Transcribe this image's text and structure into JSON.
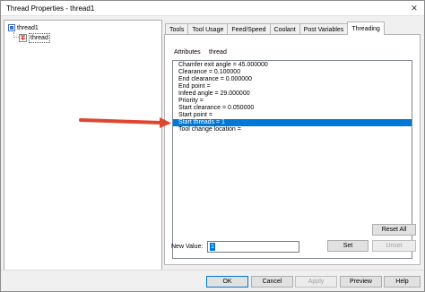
{
  "window": {
    "title": "Thread Properties - thread1",
    "close_glyph": "✕"
  },
  "tree": {
    "root": {
      "label": "thread1",
      "icon": "operation-icon"
    },
    "child": {
      "label": "thread",
      "icon": "thread-tool-icon"
    }
  },
  "tabs": [
    {
      "label": "Tools",
      "active": false
    },
    {
      "label": "Tool Usage",
      "active": false
    },
    {
      "label": "Feed/Speed",
      "active": false
    },
    {
      "label": "Coolant",
      "active": false
    },
    {
      "label": "Post Variables",
      "active": false
    },
    {
      "label": "Threading",
      "active": true
    }
  ],
  "attributes": {
    "header": "Attributes",
    "name": "thread",
    "items": [
      "Chamfer exit angle = 45.000000",
      "Clearance = 0.100000",
      "End clearance = 0.000000",
      "End point =",
      "Infeed angle = 29.000000",
      "Priority =",
      "Start clearance = 0.050000",
      "Start point =",
      "Start threads = 1",
      "Tool change location ="
    ],
    "selected_index": 8
  },
  "editor": {
    "new_value_label": "New Value:",
    "new_value": "1",
    "set_label": "Set",
    "unset_label": "Unset",
    "reset_all_label": "Reset All"
  },
  "footer": {
    "ok_label": "OK",
    "cancel_label": "Cancel",
    "apply_label": "Apply",
    "preview_label": "Preview",
    "help_label": "Help"
  },
  "colors": {
    "selection": "#0078d7",
    "arrow": "#e0452f"
  }
}
